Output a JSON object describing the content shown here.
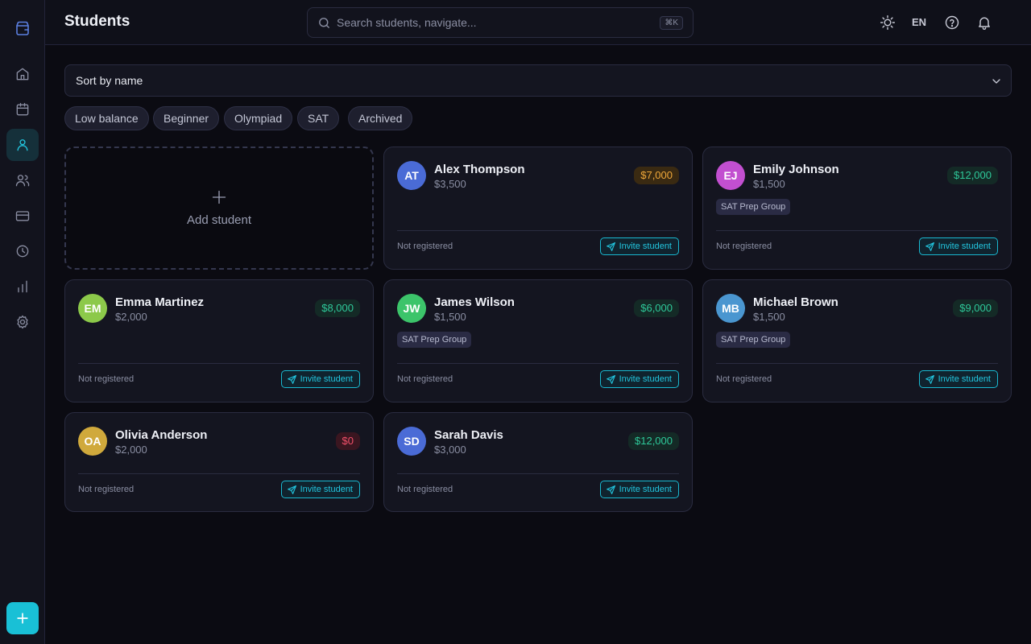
{
  "header": {
    "title": "Students",
    "search_placeholder": "Search students, navigate...",
    "search_shortcut": "⌘K",
    "language": "EN"
  },
  "sidebar": {
    "items": [
      {
        "icon": "home-icon"
      },
      {
        "icon": "calendar-icon"
      },
      {
        "icon": "student-icon",
        "active": true
      },
      {
        "icon": "users-icon"
      },
      {
        "icon": "credit-card-icon"
      },
      {
        "icon": "clock-icon"
      },
      {
        "icon": "bar-chart-icon"
      },
      {
        "icon": "settings-icon"
      }
    ],
    "accent": "#19c0d6"
  },
  "sort": {
    "label": "Sort by name"
  },
  "filters": [
    "Low balance",
    "Beginner",
    "Olympiad",
    "SAT",
    "Archived"
  ],
  "add_card": {
    "label": "Add student"
  },
  "students": [
    {
      "initials": "AT",
      "name": "Alex Thompson",
      "price": "$3,500",
      "balance": "$7,000",
      "balance_state": "warn",
      "avatar_color": "#4a6bd6",
      "group": "",
      "status": "Not registered",
      "invite": "Invite student"
    },
    {
      "initials": "EJ",
      "name": "Emily Johnson",
      "price": "$1,500",
      "balance": "$12,000",
      "balance_state": "pos",
      "avatar_color": "#c24fd0",
      "group": "SAT Prep Group",
      "status": "Not registered",
      "invite": "Invite student"
    },
    {
      "initials": "EM",
      "name": "Emma Martinez",
      "price": "$2,000",
      "balance": "$8,000",
      "balance_state": "pos",
      "avatar_color": "#8cc94a",
      "group": "",
      "status": "Not registered",
      "invite": "Invite student"
    },
    {
      "initials": "JW",
      "name": "James Wilson",
      "price": "$1,500",
      "balance": "$6,000",
      "balance_state": "pos",
      "avatar_color": "#3cc46a",
      "group": "SAT Prep Group",
      "status": "Not registered",
      "invite": "Invite student"
    },
    {
      "initials": "MB",
      "name": "Michael Brown",
      "price": "$1,500",
      "balance": "$9,000",
      "balance_state": "pos",
      "avatar_color": "#4a96d0",
      "group": "SAT Prep Group",
      "status": "Not registered",
      "invite": "Invite student"
    },
    {
      "initials": "OA",
      "name": "Olivia Anderson",
      "price": "$2,000",
      "balance": "$0",
      "balance_state": "neg",
      "avatar_color": "#d0a93c",
      "group": "",
      "status": "Not registered",
      "invite": "Invite student"
    },
    {
      "initials": "SD",
      "name": "Sarah Davis",
      "price": "$3,000",
      "balance": "$12,000",
      "balance_state": "pos",
      "avatar_color": "#4a6bd6",
      "group": "",
      "status": "Not registered",
      "invite": "Invite student"
    }
  ]
}
